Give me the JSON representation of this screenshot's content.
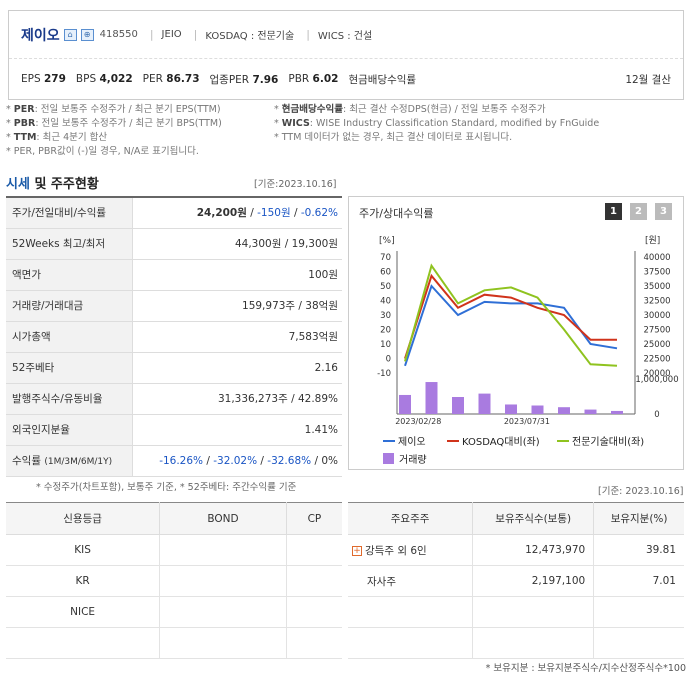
{
  "header": {
    "company": "제이오",
    "code": "418550",
    "eng_name": "JEIO",
    "market": "KOSDAQ : 전문기술",
    "wics": "WICS : 건설",
    "eps_label": "EPS",
    "eps": "279",
    "bps_label": "BPS",
    "bps": "4,022",
    "per_label": "PER",
    "per": "86.73",
    "ind_per_label": "업종PER",
    "ind_per": "7.96",
    "pbr_label": "PBR",
    "pbr": "6.02",
    "div_label": "현금배당수익률",
    "settle": "12월 결산"
  },
  "notes": {
    "per_k": "PER",
    "per_t": ": 전일 보통주 수정주가 / 최근 분기 EPS(TTM)",
    "pbr_k": "PBR",
    "pbr_t": ": 전일 보통주 수정주가 / 최근 분기 BPS(TTM)",
    "ttm_k": "TTM",
    "ttm_t": ": 최근 4분기 합산",
    "na": "* PER, PBR값이 (-)일 경우, N/A로 표기됩니다.",
    "div_k": "현금배당수익률",
    "div_t": ": 최근 결산 수정DPS(현금) / 전일 보통주 수정주가",
    "wics_k": "WICS",
    "wics_t": ": WISE Industry Classification Standard, modified by FnGuide",
    "ttm_note": "* TTM 데이터가 없는 경우, 최근 결산 데이터로 표시됩니다."
  },
  "section": {
    "title_a": "시세",
    "title_b": " 및 주주현황",
    "date": "[기준:2023.10.16]",
    "date2": "[기준: 2023.10.16]"
  },
  "quote": {
    "price_label": "주가/전일대비/수익률",
    "price": "24,200원",
    "change": "-150원",
    "rate": "-0.62%",
    "sep": " / ",
    "w52_label": "52Weeks 최고/최저",
    "w52": "44,300원 / 19,300원",
    "face_label": "액면가",
    "face": "100원",
    "vol_label": "거래량/거래대금",
    "vol": "159,973주 / 38억원",
    "mcap_label": "시가총액",
    "mcap": "7,583억원",
    "beta_label": "52주베타",
    "beta": "2.16",
    "shares_label": "발행주식수/유동비율",
    "shares": "31,336,273주 / 42.89%",
    "foreign_label": "외국인지분율",
    "foreign": "1.41%",
    "ret_label": "수익률",
    "ret_sub": "(1M/3M/6M/1Y)",
    "ret_1m": "-16.26%",
    "ret_3m": "-32.02%",
    "ret_6m": "-32.68%",
    "ret_1y": "0%",
    "note": "* 수정주가(차트포함), 보통주 기준, * 52주베타: 주간수익률 기준"
  },
  "chart_panel": {
    "title": "주가/상대수익률",
    "pages": [
      "1",
      "2",
      "3"
    ]
  },
  "chart_data": {
    "type": "line",
    "left_unit": "[%]",
    "right_unit": "[원]",
    "left_ticks": [
      "70",
      "60",
      "50",
      "40",
      "30",
      "20",
      "10",
      "0",
      "-10"
    ],
    "right_ticks": [
      "40000",
      "37500",
      "35000",
      "32500",
      "30000",
      "27500",
      "25000",
      "22500",
      "20000"
    ],
    "left_ylim": [
      -10,
      70
    ],
    "right_ylim": [
      20000,
      40000
    ],
    "x": [
      0,
      1,
      2,
      3,
      4,
      5,
      6,
      7,
      8
    ],
    "x_labels": [
      {
        "pos": 0.5,
        "text": "2023/02/28"
      },
      {
        "pos": 4.6,
        "text": "2023/07/31"
      }
    ],
    "series": [
      {
        "name": "제이오",
        "color": "#2f6fd6",
        "values": [
          -5,
          50,
          30,
          39,
          38,
          38,
          35,
          10,
          7
        ]
      },
      {
        "name": "KOSDAQ대비(좌)",
        "color": "#d0331b",
        "values": [
          0,
          57,
          35,
          44,
          42,
          35,
          30,
          13,
          13
        ]
      },
      {
        "name": "전문기술대비(좌)",
        "color": "#8fc31f",
        "values": [
          -2,
          64,
          38,
          47,
          49,
          42,
          20,
          -4,
          -5
        ]
      }
    ],
    "volume": {
      "name": "거래량",
      "color": "#a97be0",
      "ticks": [
        "1,000,000",
        "0"
      ],
      "ylim": [
        0,
        1000000
      ],
      "values": [
        560000,
        940000,
        500000,
        600000,
        280000,
        250000,
        200000,
        130000,
        90000
      ]
    }
  },
  "credit": {
    "headers": [
      "신용등급",
      "BOND",
      "CP"
    ],
    "rows": [
      [
        "KIS",
        "",
        ""
      ],
      [
        "KR",
        "",
        ""
      ],
      [
        "NICE",
        "",
        ""
      ],
      [
        "",
        "",
        ""
      ]
    ]
  },
  "holders": {
    "headers": [
      "주요주주",
      "보유주식수(보통)",
      "보유지분(%)"
    ],
    "rows": [
      [
        "강득주 외 6인",
        "12,473,970",
        "39.81"
      ],
      [
        "자사주",
        "2,197,100",
        "7.01"
      ],
      [
        "",
        "",
        ""
      ],
      [
        "",
        "",
        ""
      ]
    ],
    "note": "* 보유지분 : 보유지분주식수/지수산정주식수*100"
  }
}
